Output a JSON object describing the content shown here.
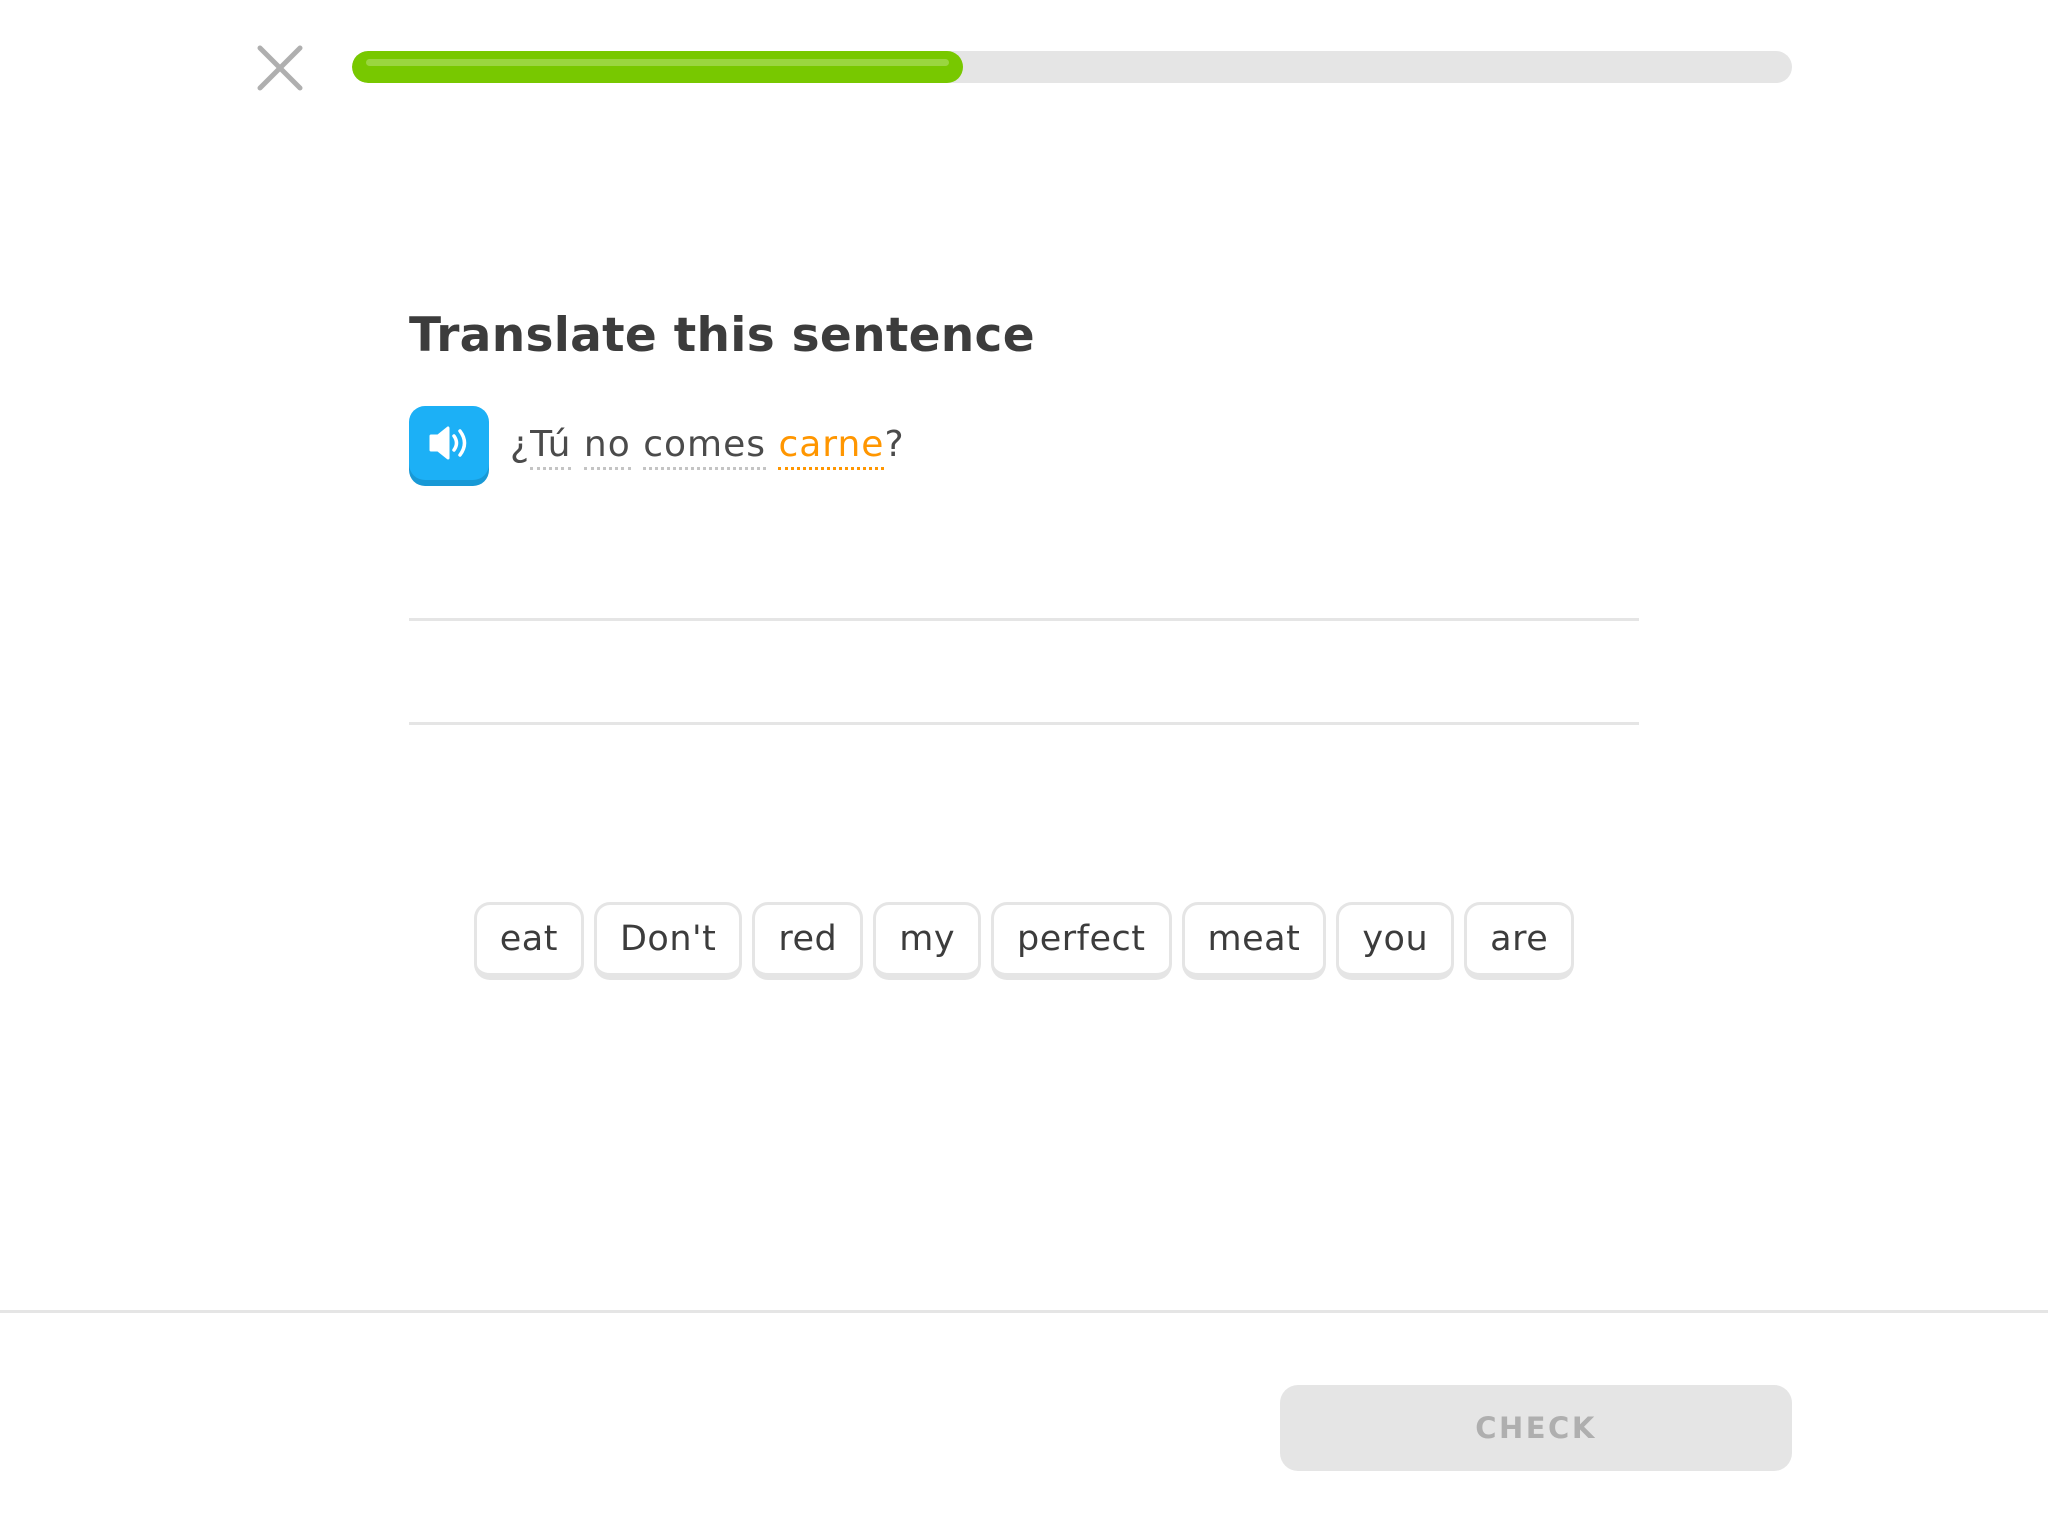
{
  "header": {
    "close_icon": "close-icon",
    "progress_fraction": 0.424,
    "progress_color": "#78c800",
    "track_color": "#e5e5e5"
  },
  "challenge": {
    "instruction": "Translate this sentence",
    "speaker_icon": "speaker-icon",
    "accent_color": "#1cb0f6",
    "sentence": {
      "lead": "¿",
      "words": [
        {
          "text": "Tú",
          "new": false
        },
        {
          "text": "no",
          "new": false
        },
        {
          "text": "comes",
          "new": false
        },
        {
          "text": "carne",
          "new": true
        }
      ],
      "trail": "?"
    }
  },
  "word_bank": [
    "eat",
    "Don't",
    "red",
    "my",
    "perfect",
    "meat",
    "you",
    "are"
  ],
  "footer": {
    "check_label": "CHECK"
  }
}
